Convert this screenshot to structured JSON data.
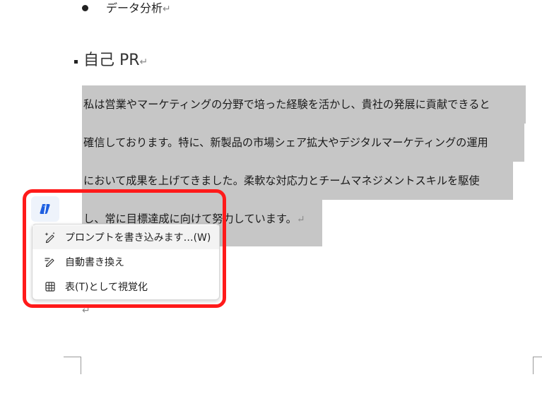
{
  "document": {
    "bullet_text": "データ分析",
    "heading": "自己 PR",
    "selected_lines": [
      "私は営業やマーケティングの分野で培った経験を活かし、貴社の発展に貢献できると",
      "確信しております。特に、新製品の市場シェア拡大やデジタルマーケティングの運用",
      "において成果を上げてきました。柔軟な対応力とチームマネジメントスキルを駆使",
      "し、常に目標達成に向けて努力しています。"
    ],
    "paragraph_mark": "↵"
  },
  "copilot": {
    "icon": "copilot-icon",
    "menu_items": [
      {
        "label": "プロンプトを書き込みます…(W)",
        "icon": "sparkle-pen-icon"
      },
      {
        "label": "自動書き換え",
        "icon": "rewrite-pen-icon"
      },
      {
        "label": "表(T)として視覚化",
        "icon": "table-icon"
      }
    ]
  },
  "colors": {
    "selection": "#c6c6c6",
    "highlight_frame": "#ff1a1a",
    "copilot_blue": "#1f5fe0"
  }
}
